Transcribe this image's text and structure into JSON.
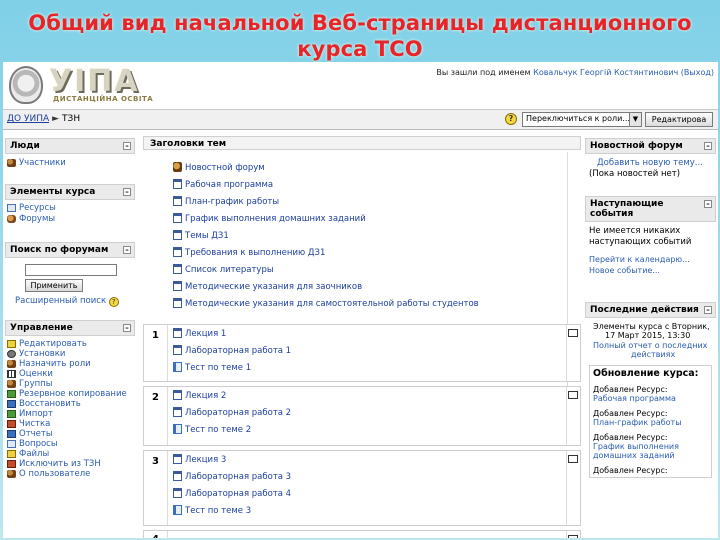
{
  "banner": {
    "line1": "Общий вид начальной  Веб-страницы дистанционного",
    "line2": "курса ТСО"
  },
  "header": {
    "logo": "УІПА",
    "logo_sub": "ДИСТАНЦІЙНА ОСВІТА",
    "login_prefix": "Вы зашли под именем",
    "login_user": "Ковальчук Георгій Костянтинович (Выход)"
  },
  "nav": {
    "home": "ДО УИПА",
    "separator": "►",
    "course": "ТЗН",
    "help": "?",
    "role_select": "Переключиться к роли...",
    "edit_button": "Редактирова"
  },
  "left": {
    "people": {
      "title": "Люди",
      "items": [
        "Участники"
      ]
    },
    "elements": {
      "title": "Элементы курса",
      "items": [
        "Ресурсы",
        "Форумы"
      ]
    },
    "search": {
      "title": "Поиск по форумам",
      "button": "Применить",
      "advanced": "Расширенный поиск"
    },
    "manage": {
      "title": "Управление",
      "items": [
        "Редактировать",
        "Установки",
        "Назначить роли",
        "Оценки",
        "Группы",
        "Резервное копирование",
        "Восстановить",
        "Импорт",
        "Чистка",
        "Отчеты",
        "Вопросы",
        "Файлы",
        "Исключить из ТЗН",
        "О пользователе"
      ]
    }
  },
  "main": {
    "topics_title": "Заголовки тем",
    "topic0": [
      "Новостной форум",
      "Рабочая программа",
      "План-график работы",
      "График выполнения домашних заданий",
      "Темы ДЗ1",
      "Требования к выполнению ДЗ1",
      "Список литературы",
      "Методические указания для заочников",
      "Методические указания для самостоятельной работы студентов"
    ],
    "sections": [
      {
        "num": "1",
        "items": [
          "Лекция 1",
          "Лабораторная работа 1",
          "Тест по теме 1"
        ]
      },
      {
        "num": "2",
        "items": [
          "Лекция 2",
          "Лабораторная работа 2",
          "Тест по теме 2"
        ]
      },
      {
        "num": "3",
        "items": [
          "Лекция 3",
          "Лабораторная работа 3",
          "Лабораторная работа 4",
          "Тест по теме 3"
        ]
      },
      {
        "num": "4",
        "items": []
      }
    ]
  },
  "right": {
    "news": {
      "title": "Новостной форум",
      "add": "Добавить новую тему...",
      "empty": "(Пока новостей нет)"
    },
    "events": {
      "title_1": "Наступающие",
      "title_2": "события",
      "text_1": "Не имеется никаких",
      "text_2": "наступающих событий",
      "calendar": "Перейти к календарю...",
      "new_event": "Новое событие..."
    },
    "recent": {
      "title": "Последние действия",
      "since_1": "Элементы курса с Вторник,",
      "since_2": "17 Март 2015, 13:30",
      "full_1": "Полный отчет о последних",
      "full_2": "действиях",
      "updates_title": "Обновление курса:",
      "updates": [
        {
          "label": "Добавлен Ресурс:",
          "item": "Рабочая программа"
        },
        {
          "label": "Добавлен Ресурс:",
          "item": "План-график работы"
        },
        {
          "label": "Добавлен Ресурс:",
          "item_1": "График выполнения",
          "item_2": "домашних заданий"
        },
        {
          "label": "Добавлен Ресурс:"
        }
      ]
    }
  }
}
